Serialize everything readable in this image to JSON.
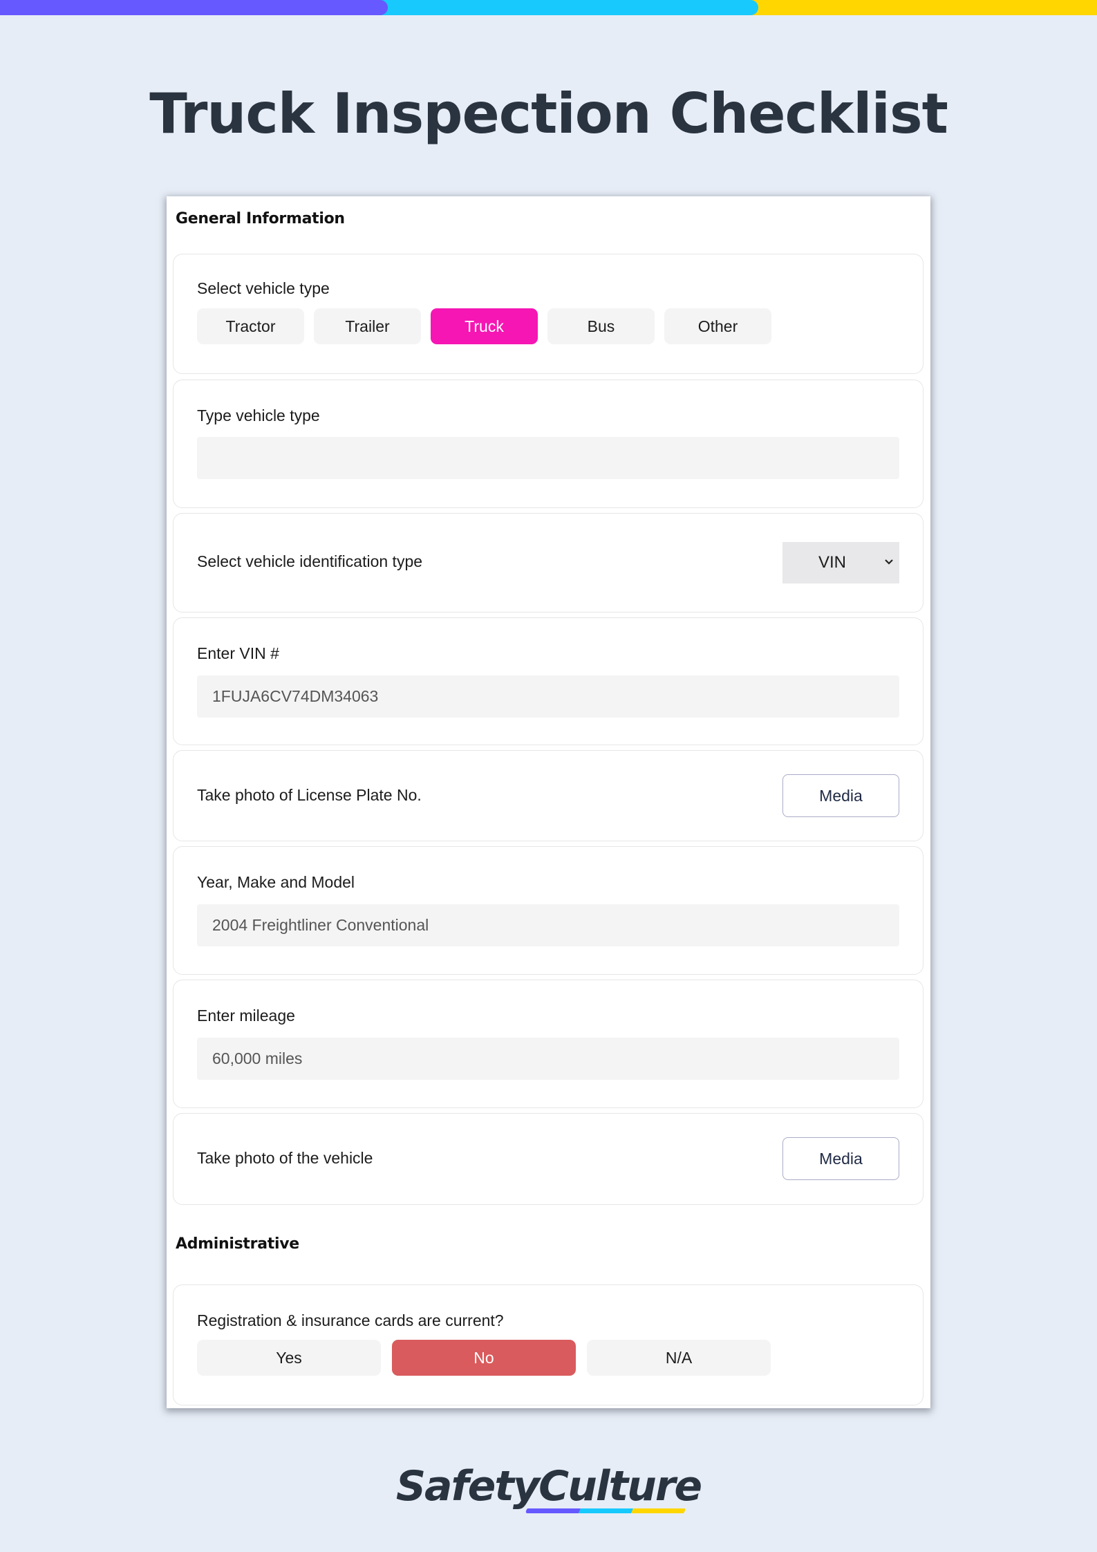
{
  "brand_colors": {
    "purple": "#6559ff",
    "cyan": "#17c9fd",
    "yellow": "#ffd600",
    "selected_pink": "#f516b4",
    "selected_red": "#d95b5d"
  },
  "title": "Truck Inspection Checklist",
  "sections": {
    "general": {
      "title": "General Information",
      "vehicle_type": {
        "label": "Select vehicle type",
        "options": [
          "Tractor",
          "Trailer",
          "Truck",
          "Bus",
          "Other"
        ],
        "selected": "Truck"
      },
      "type_vehicle_type": {
        "label": "Type vehicle type",
        "value": ""
      },
      "id_type": {
        "label": "Select vehicle identification type",
        "selected": "VIN"
      },
      "vin": {
        "label": "Enter VIN #",
        "value": "1FUJA6CV74DM34063"
      },
      "license_photo": {
        "label": "Take photo of License Plate No.",
        "button": "Media"
      },
      "year_make_model": {
        "label": "Year, Make and Model",
        "value": "2004 Freightliner Conventional"
      },
      "mileage": {
        "label": "Enter mileage",
        "value": "60,000 miles"
      },
      "vehicle_photo": {
        "label": "Take photo of the vehicle",
        "button": "Media"
      }
    },
    "administrative": {
      "title": "Administrative",
      "registration": {
        "label": "Registration & insurance cards are current?",
        "options": [
          "Yes",
          "No",
          "N/A"
        ],
        "selected": "No"
      }
    }
  },
  "logo": {
    "text": "SafetyCulture",
    "icon": "safetyculture-logo"
  }
}
